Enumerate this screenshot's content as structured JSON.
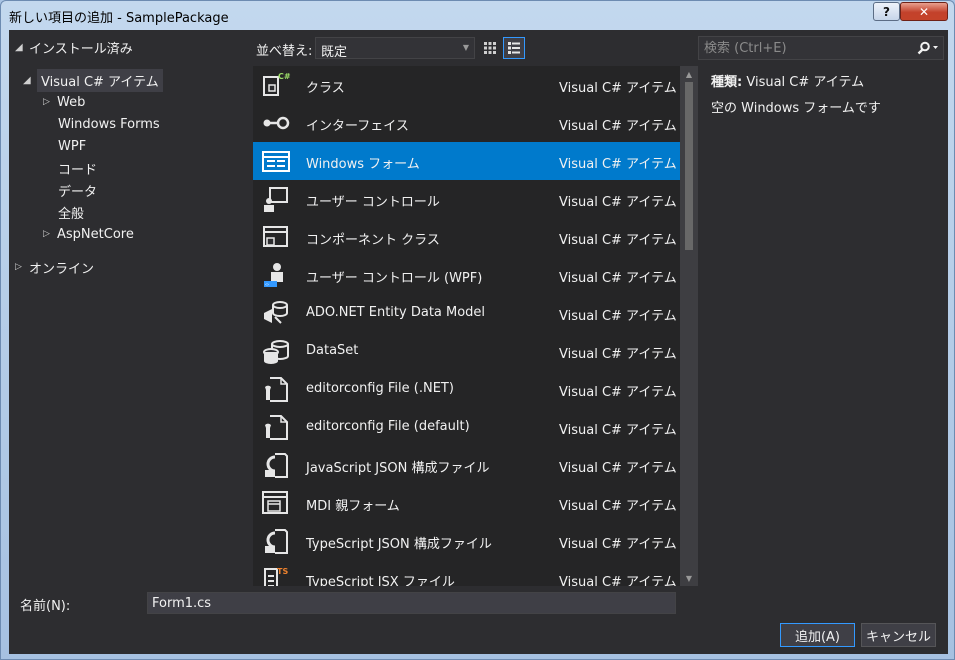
{
  "window": {
    "title": "新しい項目の追加 - SamplePackage",
    "help_label": "?",
    "close_label": "✕"
  },
  "tree": {
    "installed": "インストール済み",
    "visual_csharp": "Visual C# アイテム",
    "web": "Web",
    "windows_forms": "Windows Forms",
    "wpf": "WPF",
    "code": "コード",
    "data": "データ",
    "general": "全般",
    "aspnetcore": "AspNetCore",
    "online": "オンライン"
  },
  "toolbar": {
    "sort_label": "並べ替え:",
    "sort_value": "既定"
  },
  "search": {
    "placeholder": "検索 (Ctrl+E)"
  },
  "templates": [
    {
      "name": "クラス",
      "type": "Visual C# アイテム",
      "icon": "class-icon"
    },
    {
      "name": "インターフェイス",
      "type": "Visual C# アイテム",
      "icon": "interface-icon"
    },
    {
      "name": "Windows フォーム",
      "type": "Visual C# アイテム",
      "icon": "windows-form-icon"
    },
    {
      "name": "ユーザー コントロール",
      "type": "Visual C# アイテム",
      "icon": "user-control-icon"
    },
    {
      "name": "コンポーネント クラス",
      "type": "Visual C# アイテム",
      "icon": "component-class-icon"
    },
    {
      "name": "ユーザー コントロール (WPF)",
      "type": "Visual C# アイテム",
      "icon": "wpf-user-control-icon"
    },
    {
      "name": "ADO.NET Entity Data Model",
      "type": "Visual C# アイテム",
      "icon": "entity-data-model-icon"
    },
    {
      "name": "DataSet",
      "type": "Visual C# アイテム",
      "icon": "dataset-icon"
    },
    {
      "name": "editorconfig File (.NET)",
      "type": "Visual C# アイテム",
      "icon": "editorconfig-icon"
    },
    {
      "name": "editorconfig File (default)",
      "type": "Visual C# アイテム",
      "icon": "editorconfig-icon"
    },
    {
      "name": "JavaScript JSON 構成ファイル",
      "type": "Visual C# アイテム",
      "icon": "json-config-icon"
    },
    {
      "name": "MDI 親フォーム",
      "type": "Visual C# アイテム",
      "icon": "mdi-form-icon"
    },
    {
      "name": "TypeScript JSON 構成ファイル",
      "type": "Visual C# アイテム",
      "icon": "json-config-icon"
    },
    {
      "name": "TypeScript JSX ファイル",
      "type": "Visual C# アイテム",
      "icon": "typescript-jsx-icon"
    }
  ],
  "selected_index": 2,
  "details": {
    "type_label": "種類:",
    "type_value": "Visual C# アイテム",
    "description": "空の Windows フォームです"
  },
  "name_field": {
    "label": "名前(N):",
    "value": "Form1.cs"
  },
  "buttons": {
    "add": "追加(A)",
    "cancel": "キャンセル"
  },
  "colors": {
    "background": "#2d2d30",
    "list_background": "#252526",
    "selection": "#007acc",
    "accent": "#3399ff"
  }
}
